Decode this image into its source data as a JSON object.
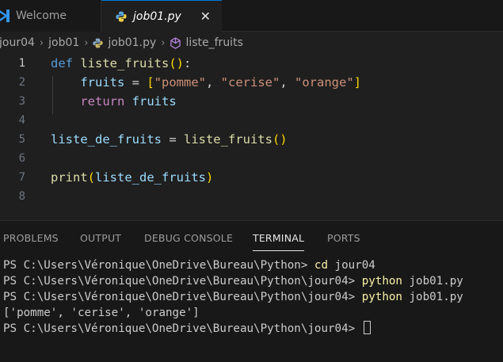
{
  "tabs": [
    {
      "label": "Welcome",
      "icon": "vscode-icon",
      "active": false
    },
    {
      "label": "job01.py",
      "icon": "python-icon",
      "active": true,
      "close": "✕"
    }
  ],
  "breadcrumb": [
    "jour04",
    "job01",
    "job01.py",
    "liste_fruits"
  ],
  "editor": {
    "current_line": "1",
    "line_numbers": [
      "1",
      "2",
      "3",
      "4",
      "5",
      "6",
      "7",
      "8"
    ]
  },
  "code": {
    "l1": {
      "def": "def",
      "fn": "liste_fruits",
      "paren": "()",
      "colon": ":"
    },
    "l2": {
      "var": "fruits",
      "eq": " = ",
      "open": "[",
      "s1": "\"pomme\"",
      "c1": ", ",
      "s2": "\"cerise\"",
      "c2": ", ",
      "s3": "\"orange\"",
      "close": "]"
    },
    "l3": {
      "ret": "return",
      "var": "fruits"
    },
    "l5": {
      "var": "liste_de_fruits",
      "eq": " = ",
      "fn": "liste_fruits",
      "paren": "()"
    },
    "l7": {
      "fn": "print",
      "open": "(",
      "var": "liste_de_fruits",
      "close": ")"
    }
  },
  "panel": {
    "tabs": [
      "PROBLEMS",
      "OUTPUT",
      "DEBUG CONSOLE",
      "TERMINAL",
      "PORTS"
    ],
    "active_tab": "TERMINAL"
  },
  "terminal": {
    "lines": [
      {
        "prompt": "PS C:\\Users\\Véronique\\OneDrive\\Bureau\\Python> ",
        "cmd": "cd",
        "args": " jour04"
      },
      {
        "prompt": "PS C:\\Users\\Véronique\\OneDrive\\Bureau\\Python\\jour04> ",
        "cmd": "python",
        "args": " job01.py"
      },
      {
        "prompt": "PS C:\\Users\\Véronique\\OneDrive\\Bureau\\Python\\jour04> ",
        "cmd": "python",
        "args": " job01.py"
      },
      {
        "output": "['pomme', 'cerise', 'orange']"
      },
      {
        "prompt": "PS C:\\Users\\Véronique\\OneDrive\\Bureau\\Python\\jour04> "
      }
    ]
  },
  "colors": {
    "accent": "#0078d4",
    "keyword": "#569cd6",
    "function": "#dcdcaa",
    "variable": "#9cdcfe",
    "string": "#ce9178",
    "bracket": "#ffd700",
    "control": "#c586c0"
  }
}
